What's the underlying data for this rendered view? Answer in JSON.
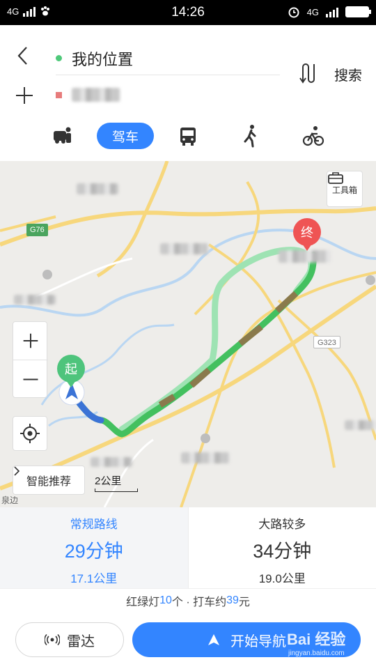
{
  "status_bar": {
    "time": "14:26",
    "network_left": "4G",
    "network_right": "4G"
  },
  "header": {
    "start_label": "我的位置",
    "search_label": "搜索"
  },
  "modes": {
    "drive_label": "驾车"
  },
  "map": {
    "toolbox_label": "工具箱",
    "smart_label": "智能推荐",
    "scale_label": "2公里",
    "road_g76": "G76",
    "road_g323": "G323",
    "start_pin": "起",
    "end_pin": "终",
    "edge_label": "泉边"
  },
  "routes": [
    {
      "name": "常规路线",
      "duration": "29分钟",
      "distance": "17.1公里"
    },
    {
      "name": "大路较多",
      "duration": "34分钟",
      "distance": "19.0公里"
    }
  ],
  "summary": {
    "prefix": "红绿灯",
    "lights": "10",
    "mid": "个 · 打车约",
    "fare": "39",
    "suffix": "元"
  },
  "buttons": {
    "radar": "雷达",
    "navigate": "开始导航"
  },
  "watermark": {
    "main": "Bai 经验",
    "sub": "jingyan.baidu.com"
  },
  "colors": {
    "accent": "#3385ff",
    "start_green": "#4ec47c",
    "end_red": "#ef5454"
  }
}
